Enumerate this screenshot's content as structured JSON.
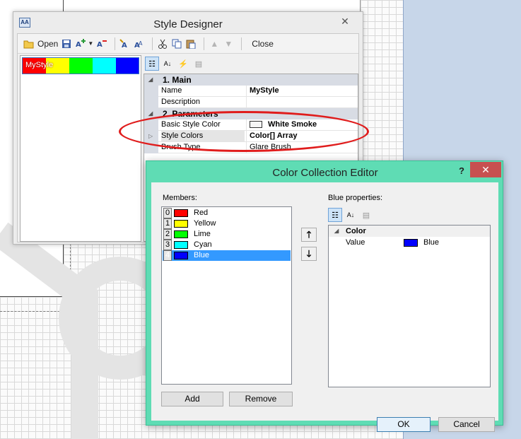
{
  "style_designer": {
    "title": "Style Designer",
    "close_glyph": "✕",
    "app_icon_text": "AA",
    "toolbar": {
      "open_label": "Open",
      "close_label": "Close"
    },
    "style_item": {
      "label": "MyStyle",
      "swatches": [
        "#ff0000",
        "#ffff00",
        "#00ff00",
        "#00ffff",
        "#0000ff"
      ]
    },
    "property_grid": {
      "categories": [
        {
          "label": "1. Main"
        },
        {
          "label": "2. Parameters"
        }
      ],
      "rows": [
        {
          "name": "Name",
          "value": "MyStyle"
        },
        {
          "name": "Description",
          "value": ""
        },
        {
          "name": "Basic Style Color",
          "value": "White Smoke"
        },
        {
          "name": "Style Colors",
          "value": "Color[] Array"
        },
        {
          "name": "Brush Type",
          "value": "Glare Brush"
        }
      ]
    }
  },
  "color_editor": {
    "title": "Color Collection Editor",
    "help_glyph": "?",
    "close_glyph": "✕",
    "members_label": "Members:",
    "members": [
      {
        "index": "0",
        "name": "Red",
        "color": "#ff0000"
      },
      {
        "index": "1",
        "name": "Yellow",
        "color": "#ffff00"
      },
      {
        "index": "2",
        "name": "Lime",
        "color": "#00ff00"
      },
      {
        "index": "3",
        "name": "Cyan",
        "color": "#00ffff"
      },
      {
        "index": "4",
        "name": "Blue",
        "color": "#0000ff"
      }
    ],
    "selected_member_index": 4,
    "move_up_glyph": "🡑",
    "move_down_glyph": "🡓",
    "add_label": "Add",
    "remove_label": "Remove",
    "properties_label": "Blue properties:",
    "properties_category": "Color",
    "property_name": "Value",
    "property_value": "Blue",
    "property_color": "#0000ff",
    "ok_label": "OK",
    "cancel_label": "Cancel"
  },
  "colors": {
    "editor_frame": "#5fdcb4",
    "close_red": "#c75050",
    "selection_blue": "#3399ff",
    "annotation_red": "#e01c1c"
  }
}
